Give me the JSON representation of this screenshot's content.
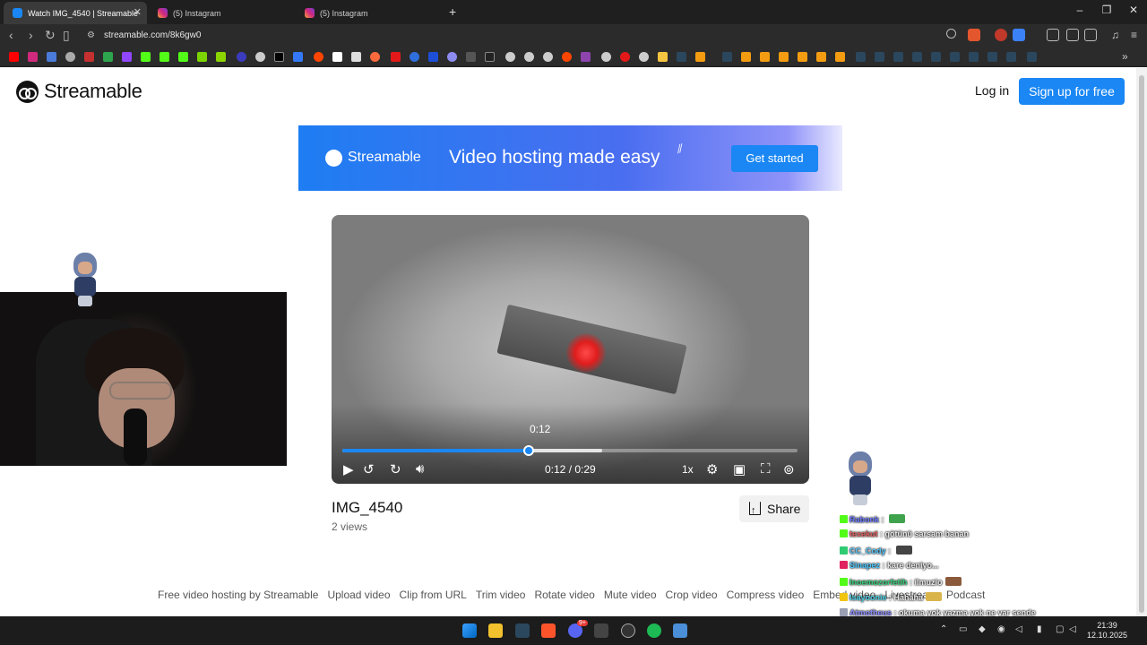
{
  "browser": {
    "tabs": [
      {
        "title": "Watch IMG_4540 | Streamable",
        "active": true,
        "icon": "streamable-icon"
      },
      {
        "title": "(5) Instagram",
        "active": false,
        "icon": "instagram-icon"
      },
      {
        "title": "(5) Instagram",
        "active": false,
        "icon": "instagram-icon"
      }
    ],
    "new_tab": "+",
    "url": "streamable.com/8k6gw0"
  },
  "site": {
    "logo_text": "Streamable",
    "login_label": "Log in",
    "signup_label": "Sign up for free"
  },
  "banner": {
    "brand": "Streamable",
    "headline": "Video hosting made easy",
    "cta": "Get started"
  },
  "video": {
    "hover_time": "0:12",
    "time_display": "0:12 / 0:29",
    "playback_rate": "1x",
    "progress_fraction": 0.41,
    "buffered_fraction": 0.57,
    "title": "IMG_4540",
    "views": "2 views",
    "share_label": "Share"
  },
  "footer_links": [
    "Free video hosting by Streamable",
    "Upload video",
    "Clip from URL",
    "Trim video",
    "Rotate video",
    "Mute video",
    "Crop video",
    "Compress video",
    "Embed video",
    "Livestream",
    "Podcast"
  ],
  "chat": [
    {
      "user": "Rabonk",
      "message": "",
      "user_color": "#6b7cff"
    },
    {
      "user": "texekut",
      "message": "götünü sarsam banan",
      "user_color": "#e35c5c"
    },
    {
      "user": "CC_Cody",
      "message": "",
      "user_color": "#55c8ff"
    },
    {
      "user": "Sinapez",
      "message": "kare deniyo...",
      "user_color": "#49c7ff"
    },
    {
      "user": "Inoemozorfetih",
      "message": "ilmuzio",
      "user_color": "#33d17a"
    },
    {
      "user": "Isayoonie",
      "message": "Hahaha",
      "user_color": "#4fd2e8"
    },
    {
      "user": "Atmotheus",
      "message": "okuma yok yazma yok ne var sende",
      "user_color": "#8a8cff"
    }
  ],
  "taskbar": {
    "time": "21:39",
    "date": "12.10.2025",
    "discord_badge": "9+"
  }
}
